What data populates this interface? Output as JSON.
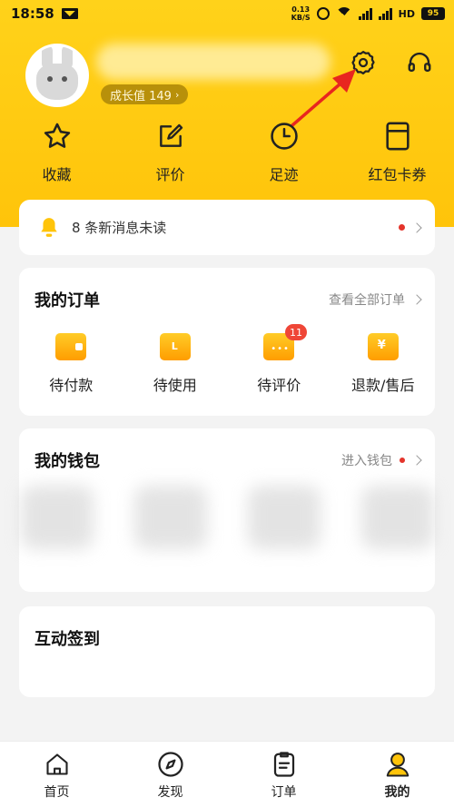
{
  "status_bar": {
    "time": "18:58",
    "speed_value": "0.13",
    "speed_unit": "KB/S",
    "network": "4G",
    "hd": "HD",
    "battery": "95"
  },
  "profile": {
    "growth_label": "成长值 149",
    "nickname": ""
  },
  "quick_actions": [
    {
      "label": "收藏",
      "icon": "star-icon"
    },
    {
      "label": "评价",
      "icon": "edit-icon"
    },
    {
      "label": "足迹",
      "icon": "clock-icon"
    },
    {
      "label": "红包卡券",
      "icon": "coupon-icon"
    }
  ],
  "messages": {
    "text": "8 条新消息未读"
  },
  "orders": {
    "title": "我的订单",
    "view_all": "查看全部订单",
    "items": [
      {
        "label": "待付款",
        "icon": "wallet-icon"
      },
      {
        "label": "待使用",
        "icon": "ticket-icon"
      },
      {
        "label": "待评价",
        "icon": "comment-icon",
        "badge": "11"
      },
      {
        "label": "退款/售后",
        "icon": "refund-icon"
      }
    ]
  },
  "wallet": {
    "title": "我的钱包",
    "enter": "进入钱包"
  },
  "sign_in": {
    "title": "互动签到"
  },
  "tabbar": [
    {
      "label": "首页",
      "icon": "home-icon"
    },
    {
      "label": "发现",
      "icon": "compass-icon"
    },
    {
      "label": "订单",
      "icon": "clipboard-icon"
    },
    {
      "label": "我的",
      "icon": "profile-icon",
      "active": true
    }
  ],
  "colors": {
    "brand_yellow": "#ffc40a",
    "badge_red": "#ef4637",
    "arrow_red": "#e8261f"
  }
}
